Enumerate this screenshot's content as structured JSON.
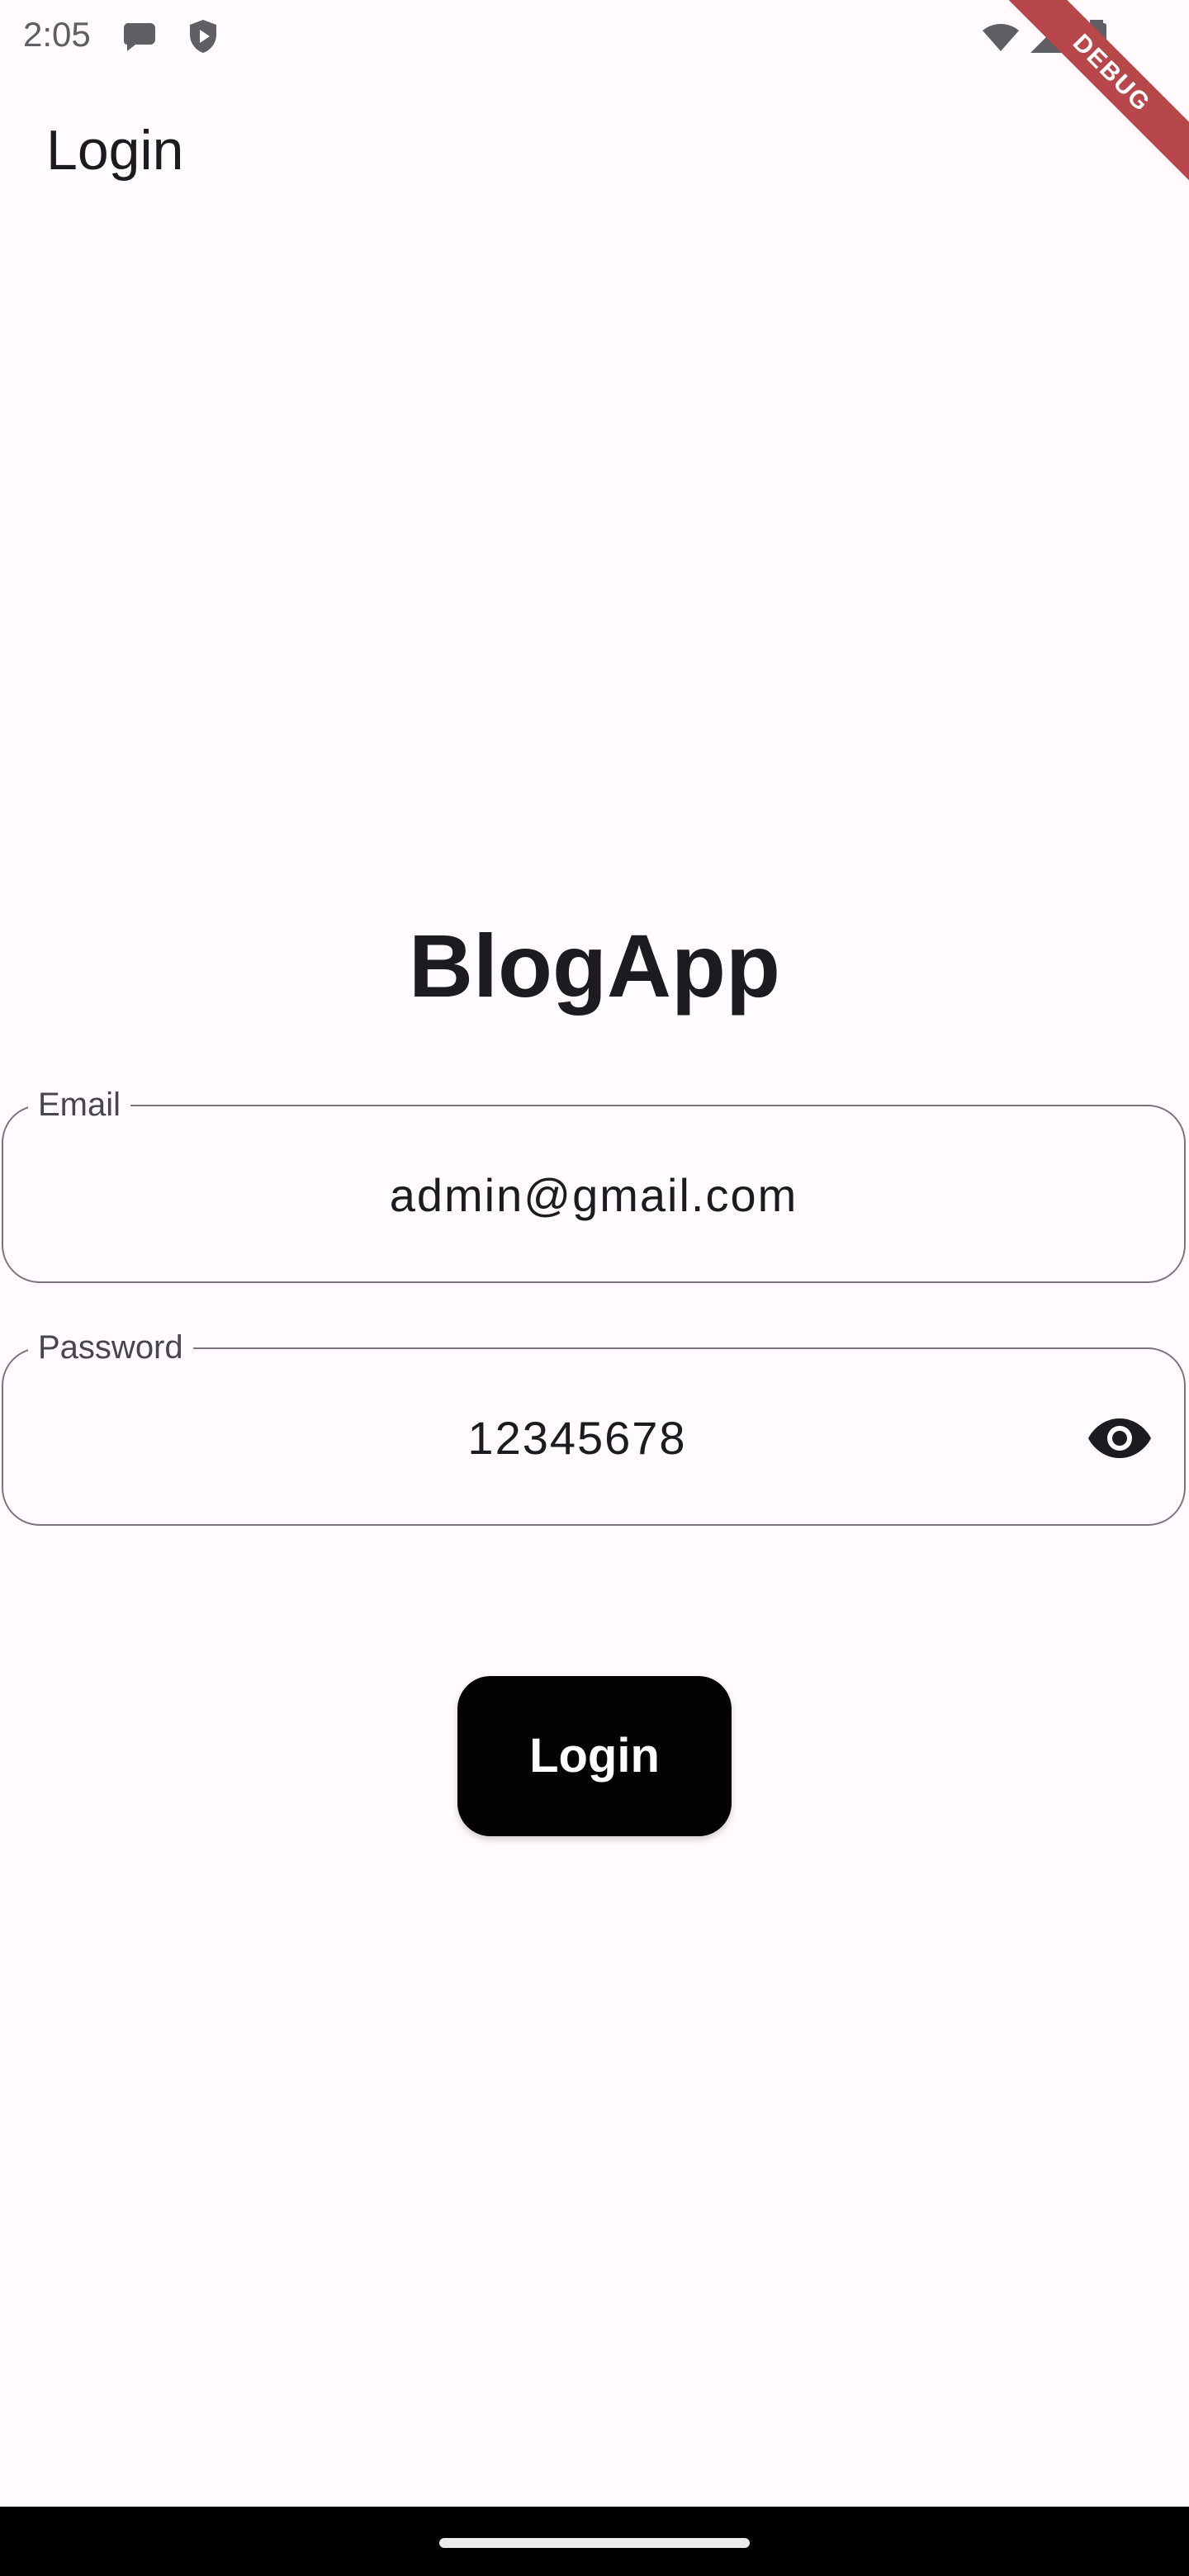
{
  "status_bar": {
    "time": "2:05",
    "left_icons": [
      "chat-bubble-icon",
      "shield-play-icon"
    ],
    "right_icons": [
      "wifi-icon",
      "cellular-signal-icon",
      "battery-icon"
    ]
  },
  "debug_banner": {
    "label": "DEBUG",
    "color": "#b7474a"
  },
  "app_bar": {
    "title": "Login"
  },
  "heading": {
    "title": "BlogApp"
  },
  "form": {
    "email": {
      "label": "Email",
      "value": "admin@gmail.com"
    },
    "password": {
      "label": "Password",
      "value": "12345678",
      "toggle_icon": "eye-icon"
    }
  },
  "login_button": {
    "label": "Login",
    "color": "#050206"
  },
  "colors": {
    "background": "#fffbfe",
    "outline": "#79747e",
    "text": "#1c1b1f"
  }
}
